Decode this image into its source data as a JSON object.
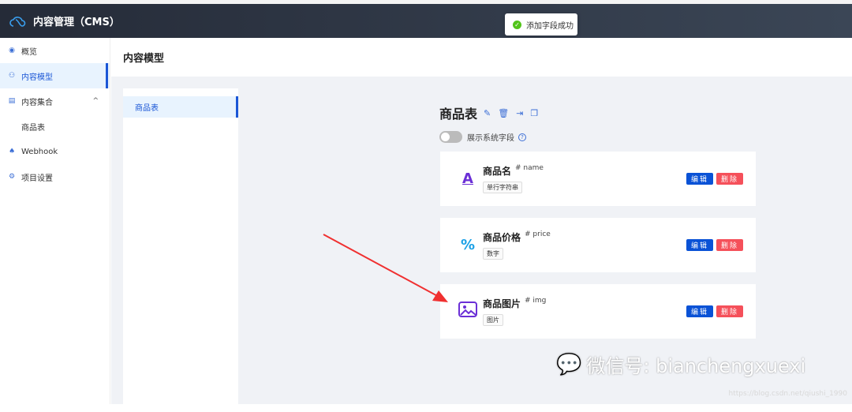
{
  "app": {
    "title": "内容管理（CMS）",
    "logo_icon": "cloud-icon"
  },
  "toast": {
    "message": "添加字段成功",
    "icon": "check-circle-icon"
  },
  "sidebar": {
    "items": [
      {
        "label": "概览",
        "icon": "eye-icon"
      },
      {
        "label": "内容模型",
        "icon": "model-icon",
        "active": true
      },
      {
        "label": "内容集合",
        "icon": "list-icon",
        "expanded": true
      },
      {
        "label": "商品表",
        "sub": true
      },
      {
        "label": "Webhook",
        "icon": "bell-icon"
      },
      {
        "label": "项目设置",
        "icon": "gear-icon"
      }
    ]
  },
  "page": {
    "title": "内容模型"
  },
  "models": [
    {
      "label": "商品表",
      "active": true
    }
  ],
  "model": {
    "title": "商品表",
    "toggle_label": "展示系统字段",
    "toggle_on": false
  },
  "fields": [
    {
      "name": "商品名",
      "key": "# name",
      "type": "单行字符串",
      "icon": "text-icon",
      "icon_color": "#6b2fd6"
    },
    {
      "name": "商品价格",
      "key": "# price",
      "type": "数字",
      "icon": "percent-icon",
      "icon_color": "#1aa0e6"
    },
    {
      "name": "商品图片",
      "key": "# img",
      "type": "图片",
      "icon": "image-icon",
      "icon_color": "#6b2fd6"
    }
  ],
  "actions": {
    "edit": "编辑",
    "delete": "删除"
  },
  "colors": {
    "accent": "#1a56d6",
    "danger": "#f5505a",
    "header": "#252b38"
  },
  "watermark": {
    "wechat": "微信号: bianchengxuexi",
    "url": "https://blog.csdn.net/qiushi_1990"
  }
}
